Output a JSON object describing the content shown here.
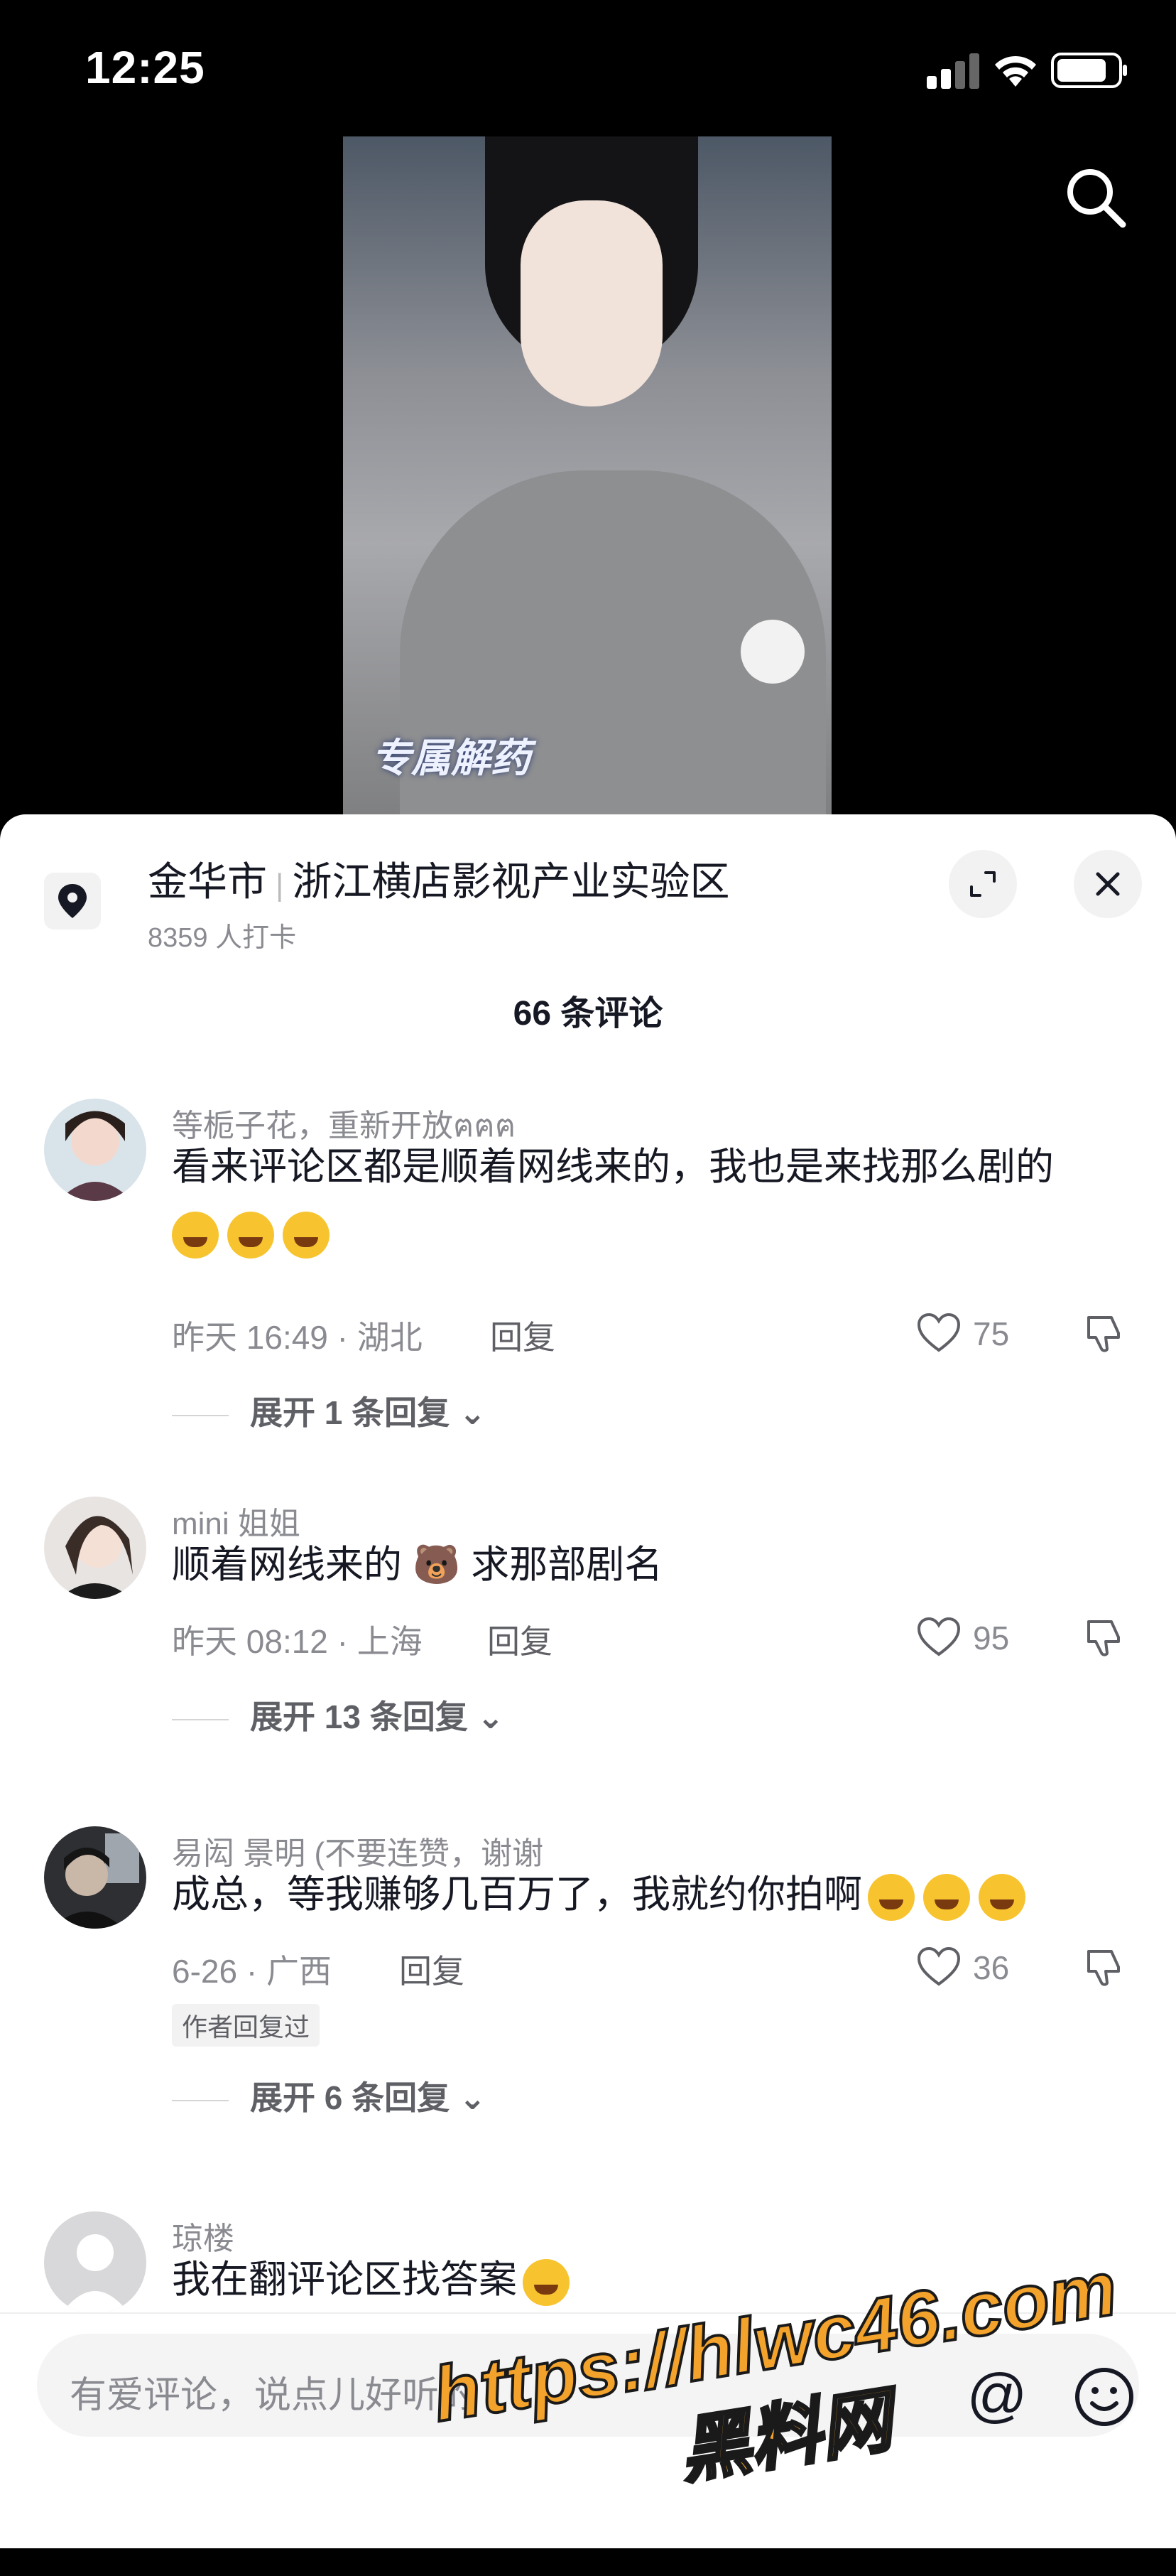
{
  "status_bar": {
    "time": "12:25"
  },
  "video": {
    "caption": "专属解药"
  },
  "location": {
    "city": "金华市",
    "place": "浙江横店影视产业实验区",
    "checkins": "8359 人打卡"
  },
  "comments_count": "66 条评论",
  "comments": [
    {
      "username": "等栀子花，重新开放ฅฅฅ",
      "text": "看来评论区都是顺着网线来的，我也是来找那么剧的",
      "emojis": [
        "cry-laugh-emoji",
        "cry-laugh-emoji",
        "cry-laugh-emoji"
      ],
      "meta": "昨天 16:49 · 湖北",
      "reply_label": "回复",
      "likes": "75",
      "expand": "展开 1 条回复"
    },
    {
      "username": "mini 姐姐",
      "text": "顺着网线来的 🐻 求那部剧名",
      "meta": "昨天 08:12 · 上海",
      "reply_label": "回复",
      "likes": "95",
      "expand": "展开 13 条回复"
    },
    {
      "username": "易闳 景明 (不要连赞，谢谢",
      "text": "成总，等我赚够几百万了，我就约你拍啊",
      "emojis": [
        "thinking-emoji",
        "thinking-emoji",
        "thinking-emoji"
      ],
      "meta": "6-26 · 广西",
      "reply_label": "回复",
      "likes": "36",
      "tag": "作者回复过",
      "expand": "展开 6 条回复"
    },
    {
      "username": "琼楼",
      "text": "我在翻评论区找答案"
    }
  ],
  "input": {
    "placeholder": "有爱评论，说点儿好听的"
  },
  "watermark": {
    "line1": "https://hlwc46.com",
    "line2": "黑料网"
  },
  "colors": {
    "accent_text": "#161823",
    "muted": "#8a8b91",
    "watermark": "#f3a32c"
  }
}
